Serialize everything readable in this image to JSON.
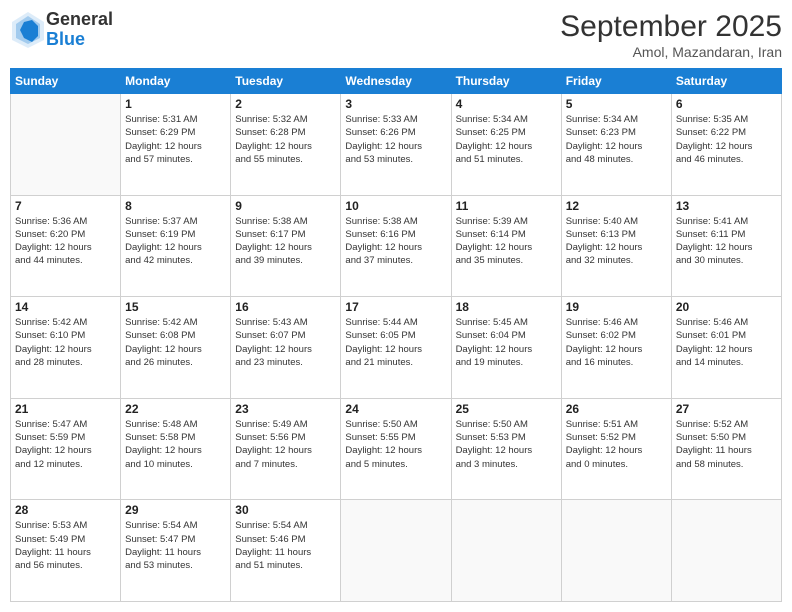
{
  "logo": {
    "general": "General",
    "blue": "Blue"
  },
  "header": {
    "month": "September 2025",
    "location": "Amol, Mazandaran, Iran"
  },
  "weekdays": [
    "Sunday",
    "Monday",
    "Tuesday",
    "Wednesday",
    "Thursday",
    "Friday",
    "Saturday"
  ],
  "weeks": [
    [
      {
        "day": "",
        "info": ""
      },
      {
        "day": "1",
        "info": "Sunrise: 5:31 AM\nSunset: 6:29 PM\nDaylight: 12 hours\nand 57 minutes."
      },
      {
        "day": "2",
        "info": "Sunrise: 5:32 AM\nSunset: 6:28 PM\nDaylight: 12 hours\nand 55 minutes."
      },
      {
        "day": "3",
        "info": "Sunrise: 5:33 AM\nSunset: 6:26 PM\nDaylight: 12 hours\nand 53 minutes."
      },
      {
        "day": "4",
        "info": "Sunrise: 5:34 AM\nSunset: 6:25 PM\nDaylight: 12 hours\nand 51 minutes."
      },
      {
        "day": "5",
        "info": "Sunrise: 5:34 AM\nSunset: 6:23 PM\nDaylight: 12 hours\nand 48 minutes."
      },
      {
        "day": "6",
        "info": "Sunrise: 5:35 AM\nSunset: 6:22 PM\nDaylight: 12 hours\nand 46 minutes."
      }
    ],
    [
      {
        "day": "7",
        "info": "Sunrise: 5:36 AM\nSunset: 6:20 PM\nDaylight: 12 hours\nand 44 minutes."
      },
      {
        "day": "8",
        "info": "Sunrise: 5:37 AM\nSunset: 6:19 PM\nDaylight: 12 hours\nand 42 minutes."
      },
      {
        "day": "9",
        "info": "Sunrise: 5:38 AM\nSunset: 6:17 PM\nDaylight: 12 hours\nand 39 minutes."
      },
      {
        "day": "10",
        "info": "Sunrise: 5:38 AM\nSunset: 6:16 PM\nDaylight: 12 hours\nand 37 minutes."
      },
      {
        "day": "11",
        "info": "Sunrise: 5:39 AM\nSunset: 6:14 PM\nDaylight: 12 hours\nand 35 minutes."
      },
      {
        "day": "12",
        "info": "Sunrise: 5:40 AM\nSunset: 6:13 PM\nDaylight: 12 hours\nand 32 minutes."
      },
      {
        "day": "13",
        "info": "Sunrise: 5:41 AM\nSunset: 6:11 PM\nDaylight: 12 hours\nand 30 minutes."
      }
    ],
    [
      {
        "day": "14",
        "info": "Sunrise: 5:42 AM\nSunset: 6:10 PM\nDaylight: 12 hours\nand 28 minutes."
      },
      {
        "day": "15",
        "info": "Sunrise: 5:42 AM\nSunset: 6:08 PM\nDaylight: 12 hours\nand 26 minutes."
      },
      {
        "day": "16",
        "info": "Sunrise: 5:43 AM\nSunset: 6:07 PM\nDaylight: 12 hours\nand 23 minutes."
      },
      {
        "day": "17",
        "info": "Sunrise: 5:44 AM\nSunset: 6:05 PM\nDaylight: 12 hours\nand 21 minutes."
      },
      {
        "day": "18",
        "info": "Sunrise: 5:45 AM\nSunset: 6:04 PM\nDaylight: 12 hours\nand 19 minutes."
      },
      {
        "day": "19",
        "info": "Sunrise: 5:46 AM\nSunset: 6:02 PM\nDaylight: 12 hours\nand 16 minutes."
      },
      {
        "day": "20",
        "info": "Sunrise: 5:46 AM\nSunset: 6:01 PM\nDaylight: 12 hours\nand 14 minutes."
      }
    ],
    [
      {
        "day": "21",
        "info": "Sunrise: 5:47 AM\nSunset: 5:59 PM\nDaylight: 12 hours\nand 12 minutes."
      },
      {
        "day": "22",
        "info": "Sunrise: 5:48 AM\nSunset: 5:58 PM\nDaylight: 12 hours\nand 10 minutes."
      },
      {
        "day": "23",
        "info": "Sunrise: 5:49 AM\nSunset: 5:56 PM\nDaylight: 12 hours\nand 7 minutes."
      },
      {
        "day": "24",
        "info": "Sunrise: 5:50 AM\nSunset: 5:55 PM\nDaylight: 12 hours\nand 5 minutes."
      },
      {
        "day": "25",
        "info": "Sunrise: 5:50 AM\nSunset: 5:53 PM\nDaylight: 12 hours\nand 3 minutes."
      },
      {
        "day": "26",
        "info": "Sunrise: 5:51 AM\nSunset: 5:52 PM\nDaylight: 12 hours\nand 0 minutes."
      },
      {
        "day": "27",
        "info": "Sunrise: 5:52 AM\nSunset: 5:50 PM\nDaylight: 11 hours\nand 58 minutes."
      }
    ],
    [
      {
        "day": "28",
        "info": "Sunrise: 5:53 AM\nSunset: 5:49 PM\nDaylight: 11 hours\nand 56 minutes."
      },
      {
        "day": "29",
        "info": "Sunrise: 5:54 AM\nSunset: 5:47 PM\nDaylight: 11 hours\nand 53 minutes."
      },
      {
        "day": "30",
        "info": "Sunrise: 5:54 AM\nSunset: 5:46 PM\nDaylight: 11 hours\nand 51 minutes."
      },
      {
        "day": "",
        "info": ""
      },
      {
        "day": "",
        "info": ""
      },
      {
        "day": "",
        "info": ""
      },
      {
        "day": "",
        "info": ""
      }
    ]
  ]
}
